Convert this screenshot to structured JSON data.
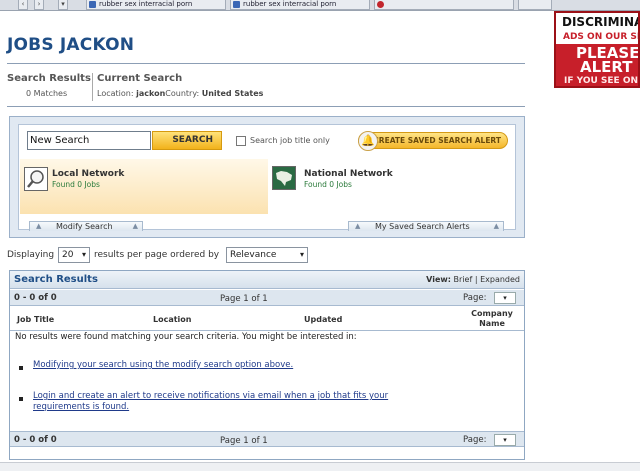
{
  "browser_tabs": [
    {
      "label": "rubber sex interracial porn"
    },
    {
      "label": "rubber sex interracial porn"
    },
    {
      "label": ""
    }
  ],
  "ad": {
    "line1": "DISCRIMINATOR",
    "line2": "ADS ON OUR SIT",
    "line3": "PLEASE",
    "line4": "ALERT US",
    "line5": "IF YOU SEE ON"
  },
  "page_title": "JOBS JACKON",
  "summary": {
    "search_results_label": "Search Results",
    "matches": "0 Matches",
    "current_search_label": "Current Search",
    "location_prefix": "Location:",
    "location_value": "jackon",
    "country_prefix": "Country:",
    "country_value": "United States"
  },
  "search": {
    "input_value": "New Search",
    "button_label": "SEARCH",
    "title_only_label": "Search job title only",
    "alert_button_label": "CREATE SAVED SEARCH ALERT"
  },
  "networks": {
    "local_title": "Local Network",
    "local_found": "Found 0 Jobs",
    "national_title": "National Network",
    "national_found": "Found 0 Jobs"
  },
  "panel_tabs": {
    "modify": "Modify Search",
    "saved_alerts": "My Saved Search Alerts"
  },
  "display": {
    "prefix": "Displaying",
    "per_page": "20",
    "middle": "results per page ordered by",
    "order": "Relevance"
  },
  "results": {
    "title": "Search Results",
    "view_prefix": "View:",
    "view_brief": "Brief",
    "view_sep": "|",
    "view_expanded": "Expanded",
    "range": "0 - 0 of 0",
    "page_info": "Page 1 of 1",
    "page_label": "Page:",
    "columns": [
      "Job Title",
      "Location",
      "Updated",
      "Company Name"
    ],
    "no_results": "No results were found matching your search criteria. You might be interested in:",
    "suggestions": [
      "Modifying your search using the modify search option above.",
      "Login and create an alert to receive notifications via email when a job that fits your requirements is found."
    ]
  },
  "colors": {
    "title_blue": "#1f4e86",
    "search_gold": "#f2b21b",
    "ad_red": "#c71f2a"
  }
}
